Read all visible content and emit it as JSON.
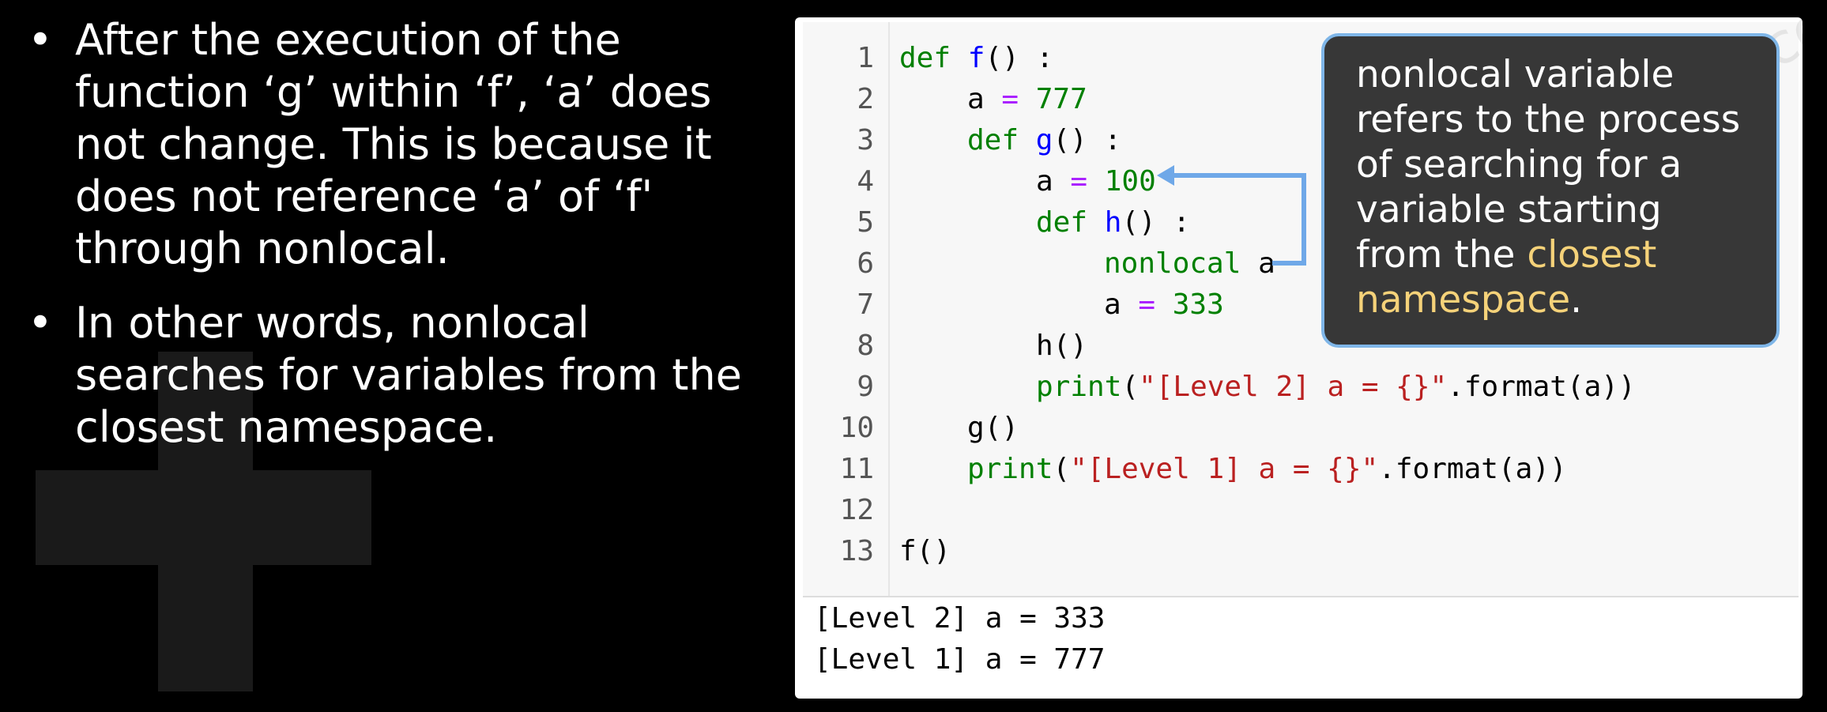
{
  "bullets": [
    "After the execution of the function ‘g’ within ‘f’, ‘a’  does not change. This is because it does not reference ‘a’ of ‘f' through nonlocal.",
    "In other words, nonlocal searches for variables from the closest namespace."
  ],
  "bullet_marker": "•",
  "code": {
    "line_numbers": [
      "1",
      "2",
      "3",
      "4",
      "5",
      "6",
      "7",
      "8",
      "9",
      "10",
      "11",
      "12",
      "13"
    ],
    "lines": {
      "l1": {
        "kw": "def",
        "fn": "f",
        "rest": "() :"
      },
      "l2": {
        "var": "a",
        "op": "=",
        "num": "777"
      },
      "l3": {
        "kw": "def",
        "fn": "g",
        "rest": "() :"
      },
      "l4": {
        "var": "a",
        "op": "=",
        "num": "100"
      },
      "l5": {
        "kw": "def",
        "fn": "h",
        "rest": "() :"
      },
      "l6": {
        "kw": "nonlocal",
        "var": "a"
      },
      "l7": {
        "var": "a",
        "op": "=",
        "num": "333"
      },
      "l8": {
        "call": "h()"
      },
      "l9": {
        "builtin": "print",
        "open": "(",
        "str": "\"[Level 2] a = {}\"",
        "rest": ".format(a))"
      },
      "l10": {
        "call": "g()"
      },
      "l11": {
        "builtin": "print",
        "open": "(",
        "str": "\"[Level 1] a = {}\"",
        "rest": ".format(a))"
      },
      "l13": {
        "call": "f()"
      }
    }
  },
  "output_lines": [
    "[Level 2] a = 333",
    "[Level 1] a = 777"
  ],
  "watermark": "...anau@gmail.com",
  "callout": {
    "text_before": "nonlocal variable refers to the process of searching for a variable starting from the ",
    "highlight": "closest namespace",
    "text_after": "."
  },
  "colors": {
    "background": "#000000",
    "callout_bg": "#373737",
    "callout_border": "#7fb6e8",
    "highlight": "#f5d279",
    "arrow": "#6fa8e8",
    "keyword": "#008000",
    "function_name": "#0000ff",
    "operator": "#aa22ff",
    "string": "#ba2121"
  }
}
